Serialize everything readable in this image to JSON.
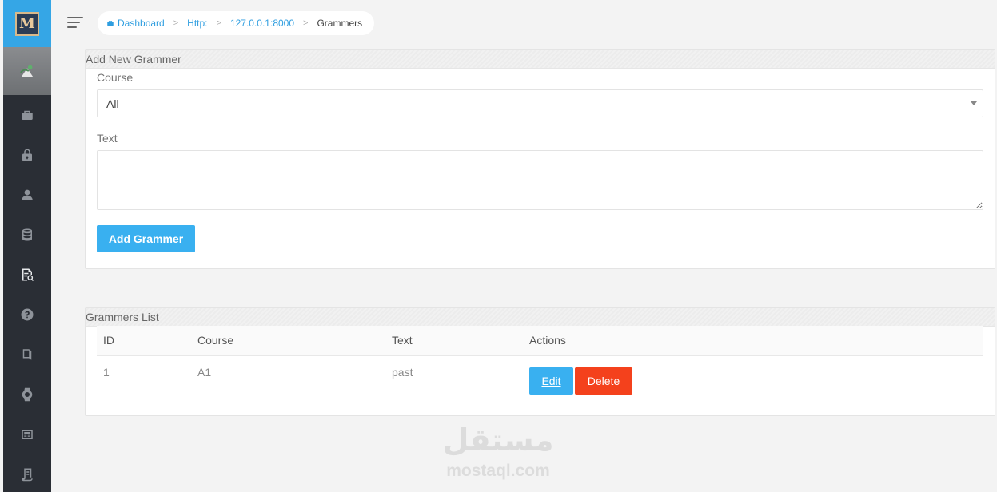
{
  "sidebar": {
    "logo_text": "M",
    "items": [
      {
        "icon": "dashboard-icon"
      },
      {
        "icon": "lock-icon"
      },
      {
        "icon": "user-icon"
      },
      {
        "icon": "database-icon"
      },
      {
        "icon": "document-search-icon",
        "active": true
      },
      {
        "icon": "question-icon"
      },
      {
        "icon": "book-icon"
      },
      {
        "icon": "watch-icon"
      },
      {
        "icon": "newspaper-icon"
      },
      {
        "icon": "scroll-icon"
      }
    ]
  },
  "breadcrumb": {
    "items": [
      "Dashboard",
      "Http:",
      "127.0.0.1:8000",
      "Grammers"
    ]
  },
  "add_form": {
    "title": "Add New Grammer",
    "course_label": "Course",
    "course_value": "All",
    "text_label": "Text",
    "text_value": "",
    "submit_label": "Add Grammer"
  },
  "list": {
    "title": "Grammers List",
    "columns": [
      "ID",
      "Course",
      "Text",
      "Actions"
    ],
    "rows": [
      {
        "id": "1",
        "course": "A1",
        "text": "past",
        "edit_label": "Edit",
        "delete_label": "Delete"
      }
    ]
  },
  "watermark": {
    "arabic": "مستقل",
    "latin": "mostaql.com"
  },
  "colors": {
    "accent": "#39b0f0",
    "danger": "#f4411c",
    "sidebar": "#2a2e35"
  }
}
